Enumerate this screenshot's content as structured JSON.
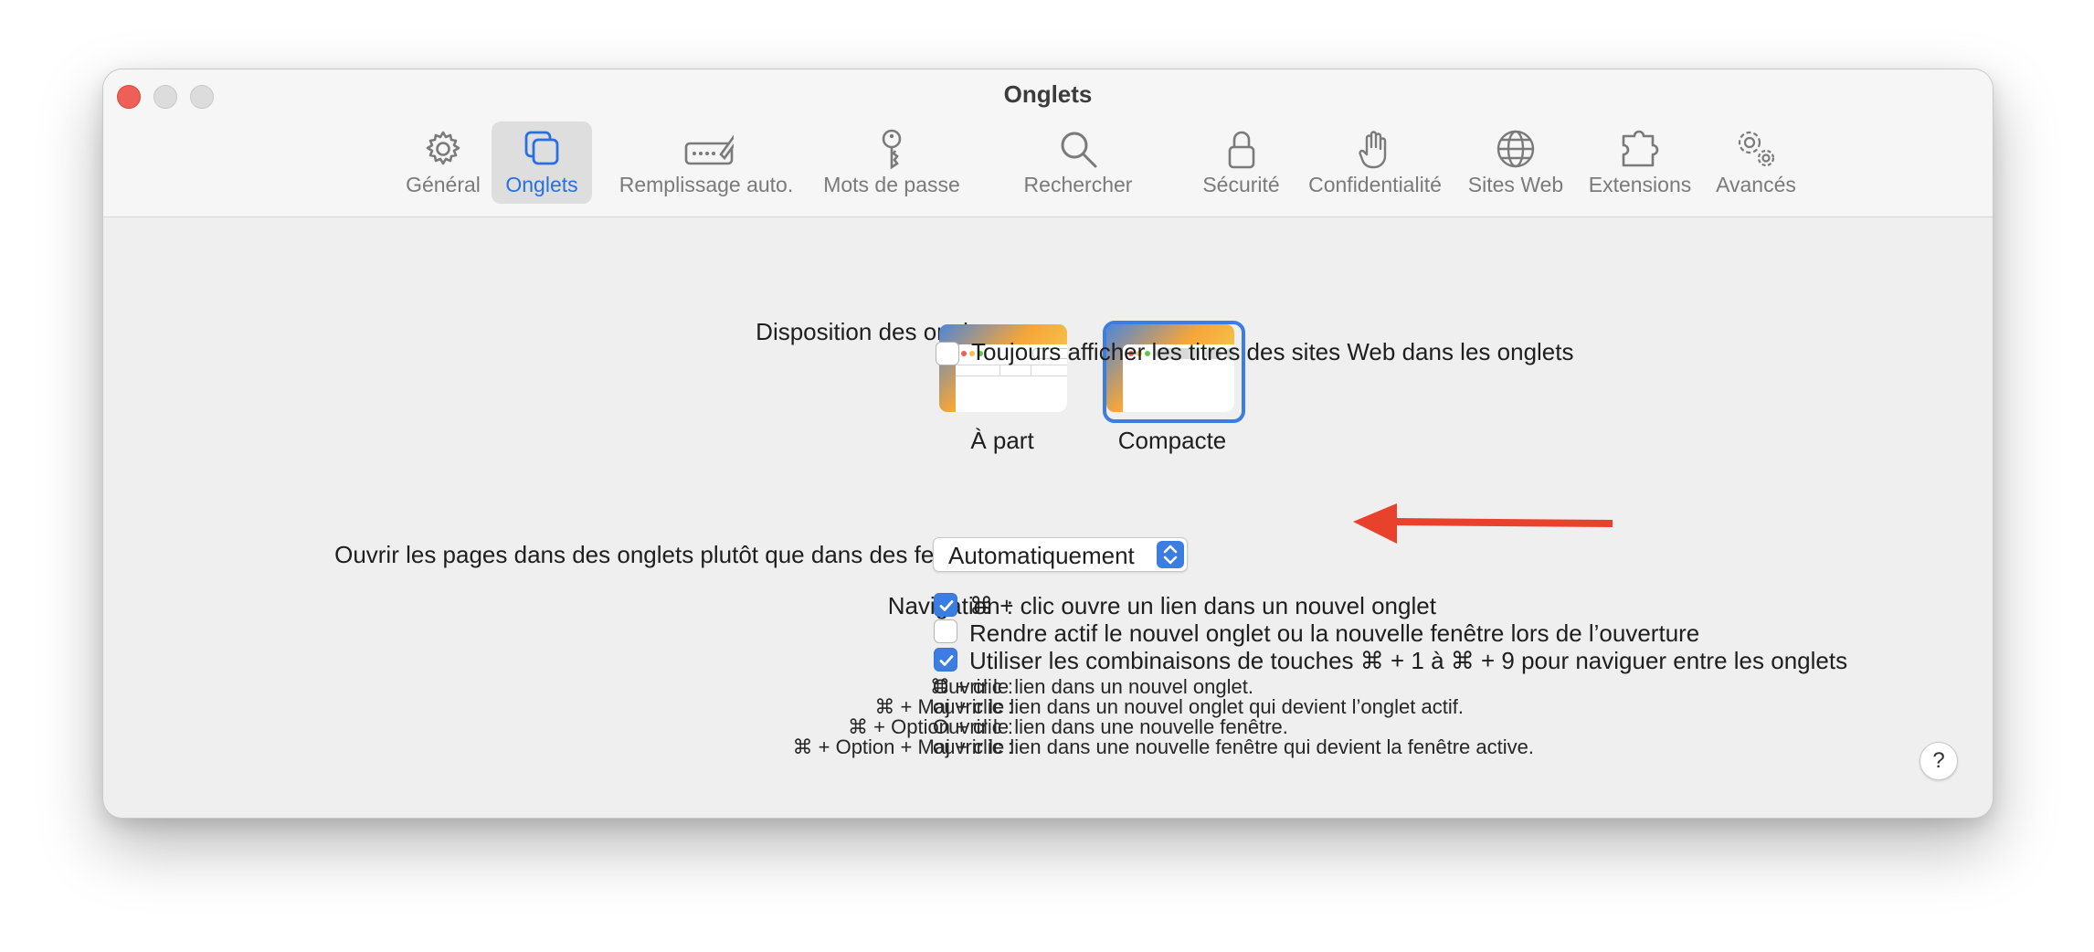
{
  "window": {
    "title": "Onglets"
  },
  "toolbar": {
    "items": [
      {
        "label": "Général",
        "icon": "gear-icon"
      },
      {
        "label": "Onglets",
        "icon": "tabs-icon",
        "active": true
      },
      {
        "label": "Remplissage auto.",
        "icon": "autofill-pencil-icon"
      },
      {
        "label": "Mots de passe",
        "icon": "key-icon"
      },
      {
        "label": "Rechercher",
        "icon": "magnifier-icon"
      },
      {
        "label": "Sécurité",
        "icon": "lock-icon"
      },
      {
        "label": "Confidentialité",
        "icon": "hand-icon"
      },
      {
        "label": "Sites Web",
        "icon": "globe-icon"
      },
      {
        "label": "Extensions",
        "icon": "puzzle-icon"
      },
      {
        "label": "Avancés",
        "icon": "gears-icon"
      }
    ]
  },
  "layout_section": {
    "label": "Disposition des onglets :",
    "options": [
      {
        "caption": "À part",
        "selected": false
      },
      {
        "caption": "Compacte",
        "selected": true
      }
    ],
    "always_show_titles": {
      "label": "Toujours afficher les titres des sites Web dans les onglets",
      "checked": false
    }
  },
  "open_pages": {
    "label": "Ouvrir les pages dans des onglets plutôt que dans des fenêtres :",
    "value": "Automatiquement"
  },
  "navigation": {
    "label": "Navigation :",
    "options": [
      {
        "label": "⌘ + clic ouvre un lien dans un nouvel onglet",
        "checked": true
      },
      {
        "label": "Rendre actif le nouvel onglet ou la nouvelle fenêtre lors de l’ouverture",
        "checked": false
      },
      {
        "label": "Utiliser les combinaisons de touches ⌘ + 1 à ⌘ + 9 pour naviguer entre les onglets",
        "checked": true
      }
    ]
  },
  "shortcuts": [
    {
      "keys": "⌘ + clic :",
      "description": "Ouvrir le lien dans un nouvel onglet."
    },
    {
      "keys": "⌘ + Maj + clic :",
      "description": "ouvrir le lien dans un nouvel onglet qui devient l’onglet actif."
    },
    {
      "keys": "⌘ + Option + clic :",
      "description": "Ouvrir le lien dans une nouvelle fenêtre."
    },
    {
      "keys": "⌘ + Option + Maj + clic :",
      "description": "ouvrir le lien dans une nouvelle fenêtre qui devient la fenêtre active."
    }
  ],
  "help": {
    "label": "?"
  },
  "colors": {
    "accent": "#3b7de0",
    "close": "#ee5f57",
    "annotation_arrow": "#e8412c"
  }
}
